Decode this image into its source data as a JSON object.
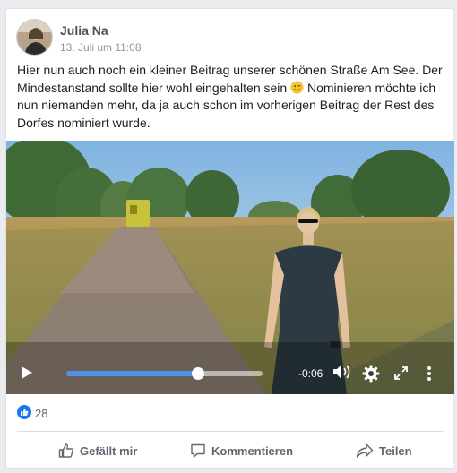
{
  "post": {
    "author": "Julia Na",
    "timestamp": "13. Juli um 11:08",
    "text_before_emoji": "Hier nun auch noch ein kleiner Beitrag unserer schönen Straße Am See. Der Mindestanstand sollte hier wohl eingehalten sein ",
    "emoji": "winking-face-emoji",
    "text_after_emoji": " Nominieren möchte ich nun niemanden mehr, da ja auch schon im vorherigen Beitrag der Rest des Dorfes nominiert wurde."
  },
  "video": {
    "remaining_time": "-0:06",
    "progress_fraction": 0.67,
    "icons": [
      "play-icon",
      "volume-icon",
      "settings-gear-icon",
      "fullscreen-icon",
      "more-options-icon"
    ]
  },
  "reactions": {
    "icon": "like-reaction-icon",
    "count": "28"
  },
  "actions": {
    "like_label": "Gefällt mir",
    "comment_label": "Kommentieren",
    "share_label": "Teilen"
  },
  "colors": {
    "accent": "#4f90ea",
    "facebook_blue": "#1877f2",
    "text_secondary": "#606770"
  }
}
